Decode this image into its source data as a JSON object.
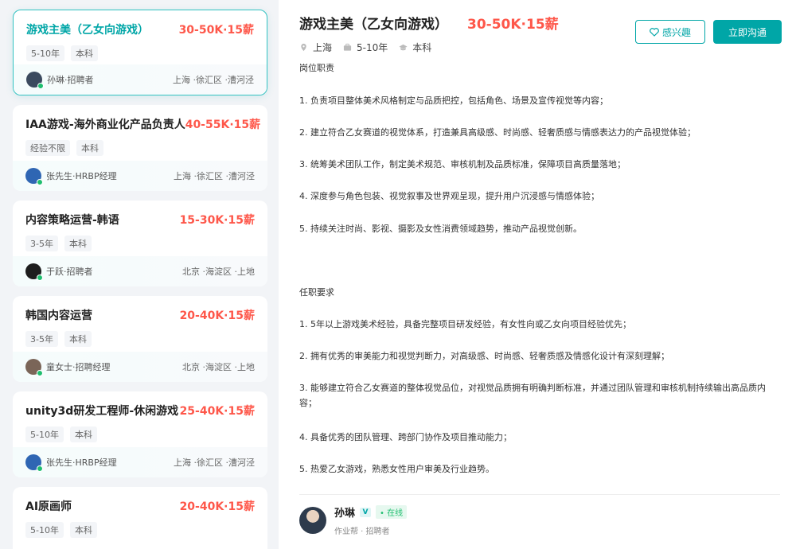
{
  "job_list": [
    {
      "title": "游戏主美（乙女向游戏）",
      "salary": "30-50K·15薪",
      "tags": [
        "5-10年",
        "本科"
      ],
      "recruiter": "孙琳·招聘者",
      "location": "上海 ·徐汇区 ·漕河泾",
      "active": true
    },
    {
      "title": "IAA游戏-海外商业化产品负责人",
      "salary": "40-55K·15薪",
      "tags": [
        "经验不限",
        "本科"
      ],
      "recruiter": "张先生·HRBP经理",
      "location": "上海 ·徐汇区 ·漕河泾"
    },
    {
      "title": "内容策略运营-韩语",
      "salary": "15-30K·15薪",
      "tags": [
        "3-5年",
        "本科"
      ],
      "recruiter": "于跃·招聘者",
      "location": "北京 ·海淀区 ·上地"
    },
    {
      "title": "韩国内容运营",
      "salary": "20-40K·15薪",
      "tags": [
        "3-5年",
        "本科"
      ],
      "recruiter": "童女士·招聘经理",
      "location": "北京 ·海淀区 ·上地"
    },
    {
      "title": "unity3d研发工程师-休闲游戏",
      "salary": "25-40K·15薪",
      "tags": [
        "5-10年",
        "本科"
      ],
      "recruiter": "张先生·HRBP经理",
      "location": "上海 ·徐汇区 ·漕河泾"
    },
    {
      "title": "AI原画师",
      "salary": "20-40K·15薪",
      "tags": [
        "5-10年",
        "本科"
      ],
      "recruiter": "",
      "location": ""
    }
  ],
  "detail": {
    "title": "游戏主美（乙女向游戏）",
    "salary": "30-50K·15薪",
    "city": "上海",
    "experience": "5-10年",
    "degree": "本科",
    "interest_label": "感兴趣",
    "chat_label": "立即沟通",
    "duty_heading": "岗位职责",
    "duties": [
      "1. 负责项目整体美术风格制定与品质把控，包括角色、场景及宣传视觉等内容；",
      "2. 建立符合乙女赛道的视觉体系，打造兼具高级感、时尚感、轻奢质感与情感表达力的产品视觉体验；",
      "3. 统筹美术团队工作，制定美术规范、审核机制及品质标准，保障项目高质量落地；",
      "4. 深度参与角色包装、视觉叙事及世界观呈现，提升用户沉浸感与情感体验；",
      "5. 持续关注时尚、影视、摄影及女性消费领域趋势，推动产品视觉创新。"
    ],
    "req_heading": "任职要求",
    "requirements": [
      "1. 5年以上游戏美术经验，具备完整项目研发经验，有女性向或乙女向项目经验优先；",
      "2. 拥有优秀的审美能力和视觉判断力，对高级感、时尚感、轻奢质感及情感化设计有深刻理解；",
      "3. 能够建立符合乙女赛道的整体视觉品位，对视觉品质拥有明确判断标准，并通过团队管理和审核机制持续输出高品质内容；",
      "4. 具备优秀的团队管理、跨部门协作及项目推动能力；",
      "5. 热爱乙女游戏，熟悉女性用户审美及行业趋势。"
    ],
    "recruiter_name": "孙琳",
    "recruiter_badge": "V",
    "recruiter_status": "• 在线",
    "recruiter_sub": "作业帮 · 招聘者"
  },
  "colors": {
    "accent": "#00a6a7",
    "salary": "#fe574a",
    "online": "#1fbe6f"
  }
}
